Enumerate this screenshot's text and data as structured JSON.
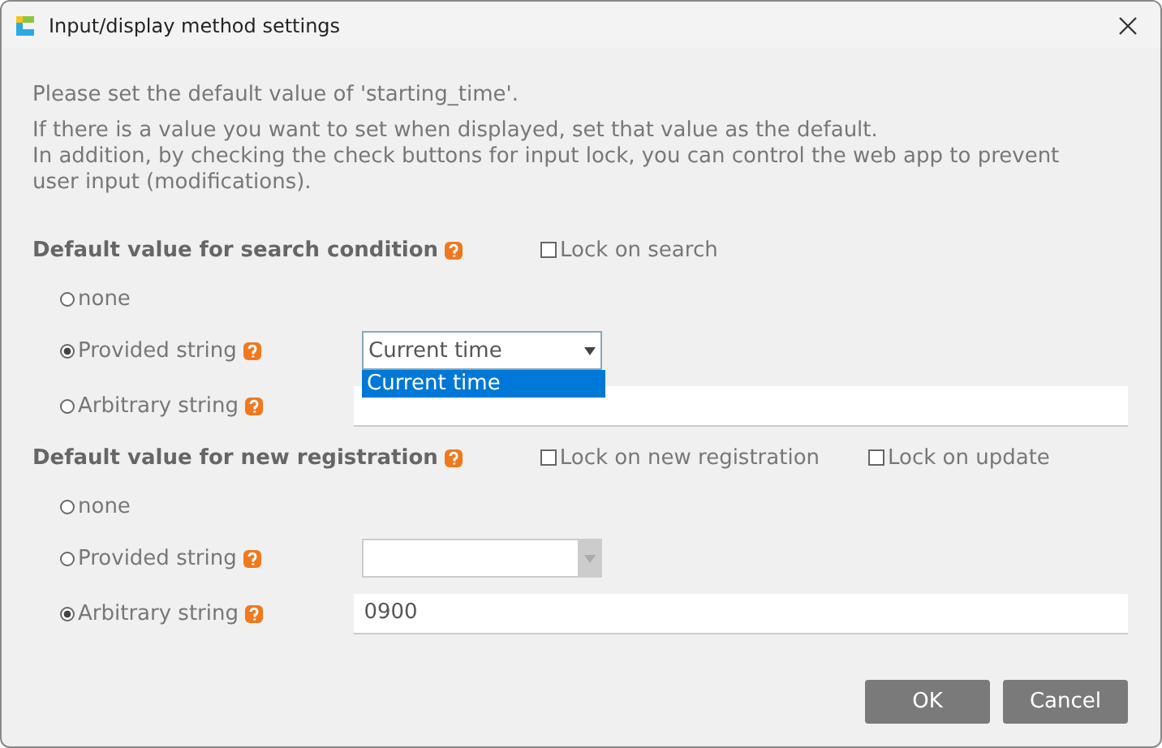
{
  "window": {
    "title": "Input/display method settings"
  },
  "intro": [
    "Please set the default value of 'starting_time'.",
    "If there is a value you want to set when displayed, set that value as the default.\nIn addition, by checking the check buttons for input lock, you can control the web app to prevent user input (modifications)."
  ],
  "sections": [
    {
      "title": "Default value for search condition",
      "locks": [
        {
          "label": "Lock on search",
          "checked": false
        }
      ],
      "options": [
        {
          "kind": "none",
          "label": "none",
          "selected": false
        },
        {
          "kind": "select",
          "label": "Provided string",
          "selected": true,
          "value": "Current time",
          "disabled": false,
          "menu": [
            {
              "label": "Current time",
              "selected": true
            }
          ]
        },
        {
          "kind": "text",
          "label": "Arbitrary string",
          "selected": false
        }
      ]
    },
    {
      "title": "Default value for new registration",
      "locks": [
        {
          "label": "Lock on new registration",
          "checked": false
        },
        {
          "label": "Lock on update",
          "checked": false
        }
      ],
      "options": [
        {
          "kind": "none",
          "label": "none",
          "selected": false
        },
        {
          "kind": "select",
          "label": "Provided string",
          "selected": false,
          "disabled": true
        },
        {
          "kind": "text",
          "label": "Arbitrary string",
          "selected": true,
          "value": "0900"
        }
      ]
    }
  ],
  "buttons": [
    "OK",
    "Cancel"
  ]
}
